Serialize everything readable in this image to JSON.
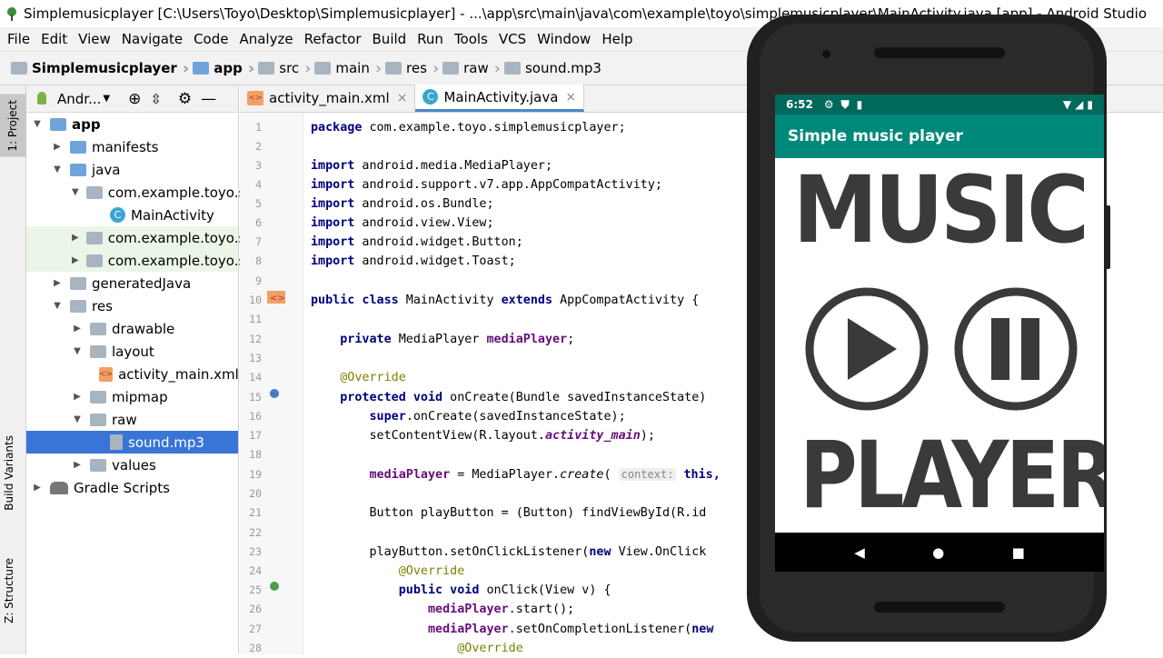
{
  "window": {
    "title": "Simplemusicplayer [C:\\Users\\Toyo\\Desktop\\Simplemusicplayer] - ...\\app\\src\\main\\java\\com\\example\\toyo\\simplemusicplayer\\MainActivity.java [app] - Android Studio"
  },
  "menu": [
    "File",
    "Edit",
    "View",
    "Navigate",
    "Code",
    "Analyze",
    "Refactor",
    "Build",
    "Run",
    "Tools",
    "VCS",
    "Window",
    "Help"
  ],
  "breadcrumb": [
    "Simplemusicplayer",
    "app",
    "src",
    "main",
    "res",
    "raw",
    "sound.mp3"
  ],
  "left_tool_tabs": {
    "project": "1: Project",
    "build_variants": "Build Variants",
    "structure": "Z: Structure"
  },
  "project_panel": {
    "view_selector": "Andr...",
    "tree": [
      {
        "label": "app",
        "depth": 0,
        "expanded": true,
        "bold": true
      },
      {
        "label": "manifests",
        "depth": 1,
        "expanded": false
      },
      {
        "label": "java",
        "depth": 1,
        "expanded": true
      },
      {
        "label": "com.example.toyo.sir",
        "depth": 2,
        "expanded": true
      },
      {
        "label": "MainActivity",
        "depth": 3
      },
      {
        "label": "com.example.toyo.sir",
        "depth": 2,
        "expanded": false
      },
      {
        "label": "com.example.toyo.sir",
        "depth": 2,
        "expanded": false
      },
      {
        "label": "generatedJava",
        "depth": 1,
        "expanded": false
      },
      {
        "label": "res",
        "depth": 1,
        "expanded": true
      },
      {
        "label": "drawable",
        "depth": 2,
        "expanded": false
      },
      {
        "label": "layout",
        "depth": 2,
        "expanded": true
      },
      {
        "label": "activity_main.xml",
        "depth": 3
      },
      {
        "label": "mipmap",
        "depth": 2,
        "expanded": false
      },
      {
        "label": "raw",
        "depth": 2,
        "expanded": true
      },
      {
        "label": "sound.mp3",
        "depth": 3,
        "selected": true
      },
      {
        "label": "values",
        "depth": 2,
        "expanded": false
      },
      {
        "label": "Gradle Scripts",
        "depth": 0,
        "expanded": false
      }
    ]
  },
  "editor": {
    "tabs": [
      {
        "label": "activity_main.xml",
        "active": false
      },
      {
        "label": "MainActivity.java",
        "active": true
      }
    ],
    "line_numbers": [
      "1",
      "2",
      "3",
      "4",
      "5",
      "6",
      "7",
      "8",
      "9",
      "10",
      "11",
      "12",
      "13",
      "14",
      "15",
      "16",
      "17",
      "18",
      "19",
      "20",
      "21",
      "22",
      "23",
      "24",
      "25",
      "26",
      "27",
      "28"
    ],
    "code": {
      "l1": "package com.example.toyo.simplemusicplayer;",
      "l3a": "import",
      "l3b": " android.media.MediaPlayer;",
      "l4a": "import",
      "l4b": " android.support.v7.app.AppCompatActivity;",
      "l5a": "import",
      "l5b": " android.os.Bundle;",
      "l6a": "import",
      "l6b": " android.view.View;",
      "l7a": "import",
      "l7b": " android.widget.Button;",
      "l8a": "import",
      "l8b": " android.widget.Toast;",
      "l10a": "public class",
      "l10b": " MainActivity ",
      "l10c": "extends",
      "l10d": " AppCompatActivity {",
      "l12a": "    private",
      "l12b": " MediaPlayer ",
      "l12c": "mediaPlayer",
      "l12d": ";",
      "l14": "    @Override",
      "l15a": "    protected void",
      "l15b": " onCreate(Bundle savedInstanceState)",
      "l16a": "        super",
      "l16b": ".onCreate(savedInstanceState);",
      "l17a": "        setContentView(R.layout.",
      "l17b": "activity_main",
      "l17c": ");",
      "l19a": "        mediaPlayer",
      "l19b": " = MediaPlayer.",
      "l19c": "create",
      "l19d": "( ",
      "l19e": "context:",
      "l19f": " this,",
      "l21": "        Button playButton = (Button) findViewById(R.id",
      "l23a": "        playButton.setOnClickListener(",
      "l23b": "new",
      "l23c": " View.OnClick",
      "l24": "            @Override",
      "l25a": "            public void",
      "l25b": " onClick(View v) {",
      "l26a": "                mediaPlayer",
      "l26b": ".start();",
      "l27a": "                mediaPlayer",
      "l27b": ".setOnCompletionListener(",
      "l27c": "new",
      "l28": "                    @Override"
    }
  },
  "phone": {
    "status_time": "6:52",
    "app_title": "Simple music player",
    "word_top": "MUSIC",
    "word_bottom": "PLAYER",
    "colors": {
      "status": "#00695c",
      "actionbar": "#00897b",
      "glyph": "#3a3a3a"
    }
  }
}
